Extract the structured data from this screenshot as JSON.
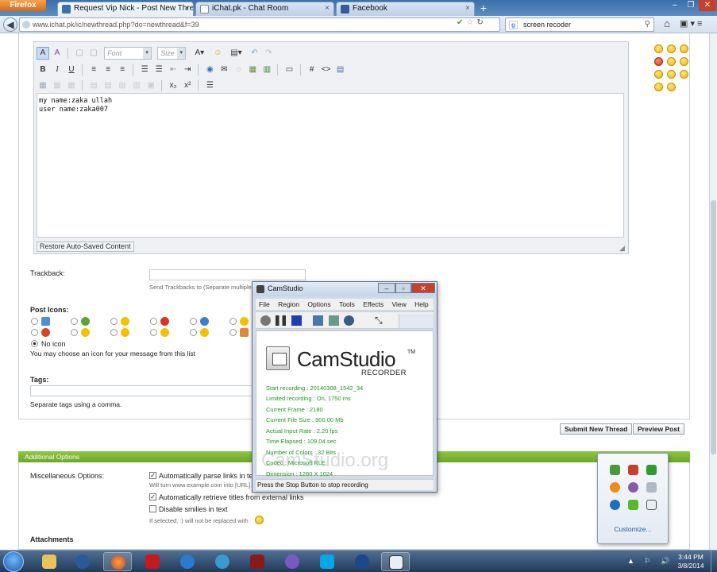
{
  "browser": {
    "app_button": "Firefox",
    "tabs": [
      {
        "title": "Request Vip Nick - Post New Thread",
        "close": "×"
      },
      {
        "title": "iChat.pk - Chat Room",
        "close": "×"
      },
      {
        "title": "Facebook",
        "close": "×"
      }
    ],
    "new_tab": "+",
    "url": "www.ichat.pk/ic/newthread.php?do=newthread&f=39",
    "search_value": "screen recoder",
    "window_controls": [
      "–",
      "❐",
      "✕"
    ]
  },
  "editor": {
    "font_placeholder": "Font",
    "size_placeholder": "Size",
    "content_line1": "my name:zaka ullah",
    "content_line2": "user name:zaka007",
    "restore_label": "Restore Auto-Saved Content",
    "toolbar_row2": [
      "B",
      "I",
      "U"
    ]
  },
  "form": {
    "trackback_label": "Trackback:",
    "trackback_note": "Send Trackbacks to (Separate multiple",
    "post_icons_label": "Post Icons:",
    "no_icon_label": "No icon",
    "post_icons_note": "You may choose an icon for your message from this list",
    "tags_label": "Tags:",
    "tags_note": "Separate tags using a comma.",
    "submit_label": "Submit New Thread",
    "preview_label": "Preview Post"
  },
  "additional": {
    "header": "Additional Options",
    "misc_label": "Miscellaneous Options:",
    "opt_parse_links": "Automatically parse links in te",
    "opt_parse_note": "Will turn www.example.com into [URL]",
    "opt_retrieve_titles": "Automatically retrieve titles from external links",
    "opt_disable_smilies": "Disable smilies in text",
    "opt_disable_note": "If selected, :) will not be replaced with",
    "attachments_label": "Attachments"
  },
  "camstudio": {
    "title": "CamStudio",
    "menu": [
      "File",
      "Region",
      "Options",
      "Tools",
      "Effects",
      "View",
      "Help"
    ],
    "brand": "CamStudio",
    "tm": "TM",
    "subtitle": "RECORDER",
    "stats": [
      "Start recording : 20140308_1542_34",
      "Limited recording : On, 1750 ms",
      "Current Frame : 2180",
      "Current File Size : 900.00 Mb",
      "Actual Input Rate : 2.20 fps",
      "Time Elapsed : 109.04 sec",
      "Number of Colors : 32 Bits",
      "Codec : Microsoft RLE",
      "Dimension : 1280 X 1024"
    ],
    "watermark": "CamStudio.org",
    "status": "Press the Stop Button to stop recording"
  },
  "tray_popup": {
    "customize": "Customize..."
  },
  "taskbar": {
    "clock_time": "3:44 PM",
    "clock_date": "3/8/2014",
    "tray_icons": "▲ ⚐ 🔊"
  },
  "colors": {
    "accent_green": "#7ab634",
    "cam_stat_green": "#1e9a1e",
    "taskbar_blue": "#223a58"
  }
}
